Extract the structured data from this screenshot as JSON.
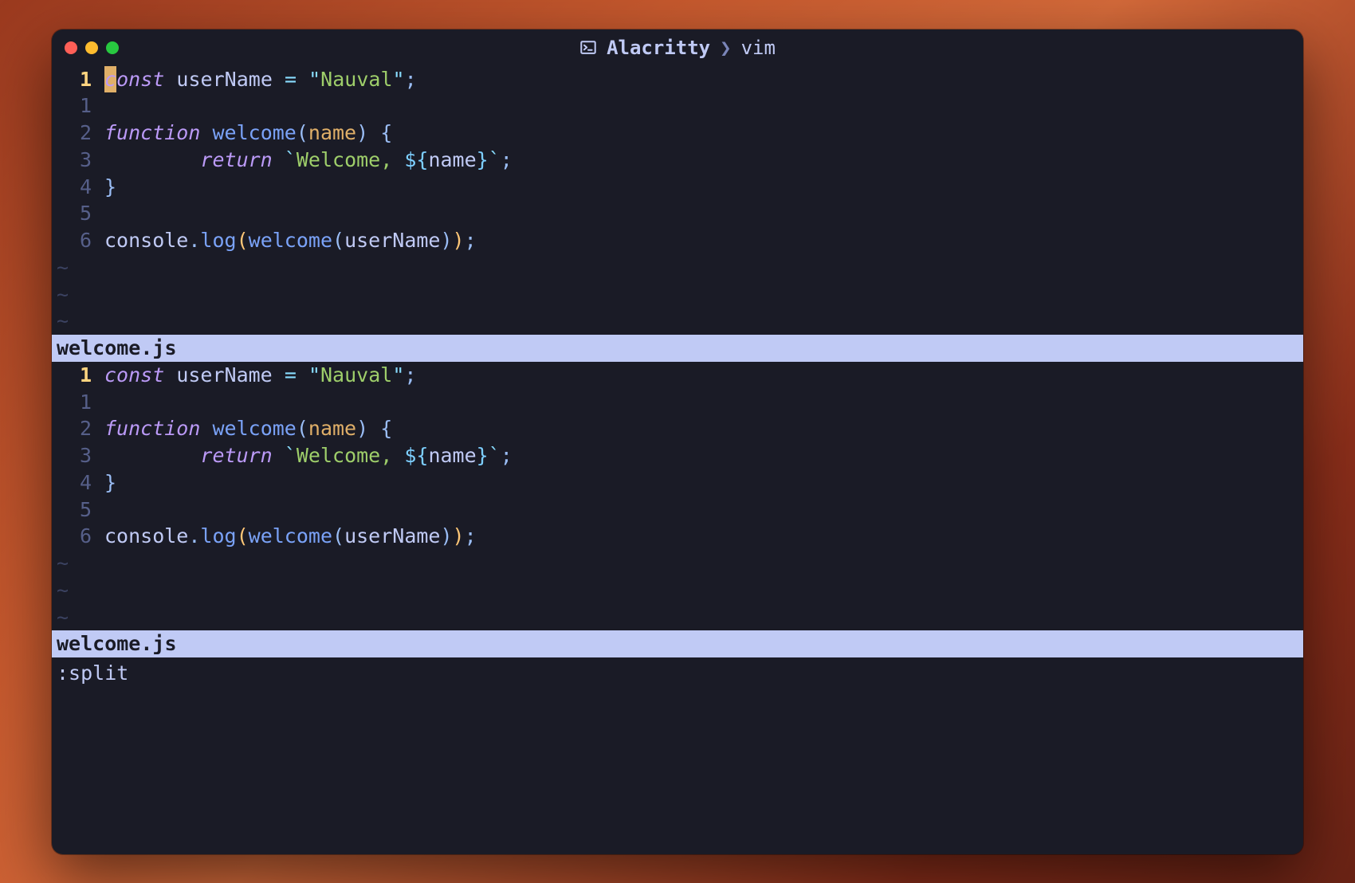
{
  "window": {
    "app": "Alacritty",
    "separator": "❯",
    "process": "vim"
  },
  "panes": [
    {
      "active": true,
      "cursor": {
        "row": 0,
        "col": 0
      },
      "abs_line": "1",
      "rel_lines": [
        "1",
        "2",
        "3",
        "4",
        "5",
        "6"
      ],
      "statusbar": "welcome.js",
      "tilde_count": 3
    },
    {
      "active": false,
      "abs_line": "1",
      "rel_lines": [
        "1",
        "2",
        "3",
        "4",
        "5",
        "6"
      ],
      "statusbar": "welcome.js",
      "tilde_count": 3
    }
  ],
  "source": {
    "lines": [
      {
        "tokens": [
          {
            "t": "const",
            "c": "kw"
          },
          {
            "t": " ",
            "c": "var"
          },
          {
            "t": "userName",
            "c": "var"
          },
          {
            "t": " ",
            "c": "var"
          },
          {
            "t": "=",
            "c": "op"
          },
          {
            "t": " ",
            "c": "var"
          },
          {
            "t": "\"",
            "c": "strd"
          },
          {
            "t": "Nauval",
            "c": "str"
          },
          {
            "t": "\"",
            "c": "strd"
          },
          {
            "t": ";",
            "c": "punc"
          }
        ]
      },
      {
        "tokens": []
      },
      {
        "tokens": [
          {
            "t": "function",
            "c": "kw"
          },
          {
            "t": " ",
            "c": "var"
          },
          {
            "t": "welcome",
            "c": "func"
          },
          {
            "t": "(",
            "c": "punc"
          },
          {
            "t": "name",
            "c": "param"
          },
          {
            "t": ")",
            "c": "punc"
          },
          {
            "t": " ",
            "c": "var"
          },
          {
            "t": "{",
            "c": "punc"
          }
        ]
      },
      {
        "tokens": [
          {
            "t": "        ",
            "c": "var"
          },
          {
            "t": "return",
            "c": "kw"
          },
          {
            "t": " ",
            "c": "var"
          },
          {
            "t": "`",
            "c": "strd"
          },
          {
            "t": "Welcome, ",
            "c": "str"
          },
          {
            "t": "${",
            "c": "tmpl"
          },
          {
            "t": "name",
            "c": "var"
          },
          {
            "t": "}",
            "c": "tmpl"
          },
          {
            "t": "`",
            "c": "strd"
          },
          {
            "t": ";",
            "c": "punc"
          }
        ]
      },
      {
        "tokens": [
          {
            "t": "}",
            "c": "punc"
          }
        ]
      },
      {
        "tokens": []
      },
      {
        "tokens": [
          {
            "t": "console",
            "c": "obj"
          },
          {
            "t": ".",
            "c": "punc"
          },
          {
            "t": "log",
            "c": "func"
          },
          {
            "t": "(",
            "c": "punc2"
          },
          {
            "t": "welcome",
            "c": "func"
          },
          {
            "t": "(",
            "c": "punc"
          },
          {
            "t": "userName",
            "c": "var"
          },
          {
            "t": ")",
            "c": "punc"
          },
          {
            "t": ")",
            "c": "punc2"
          },
          {
            "t": ";",
            "c": "punc"
          }
        ]
      }
    ]
  },
  "command_line": ":split",
  "colors": {
    "bg": "#1a1b26",
    "fg": "#c0caf5",
    "accent": "#e0af68"
  }
}
